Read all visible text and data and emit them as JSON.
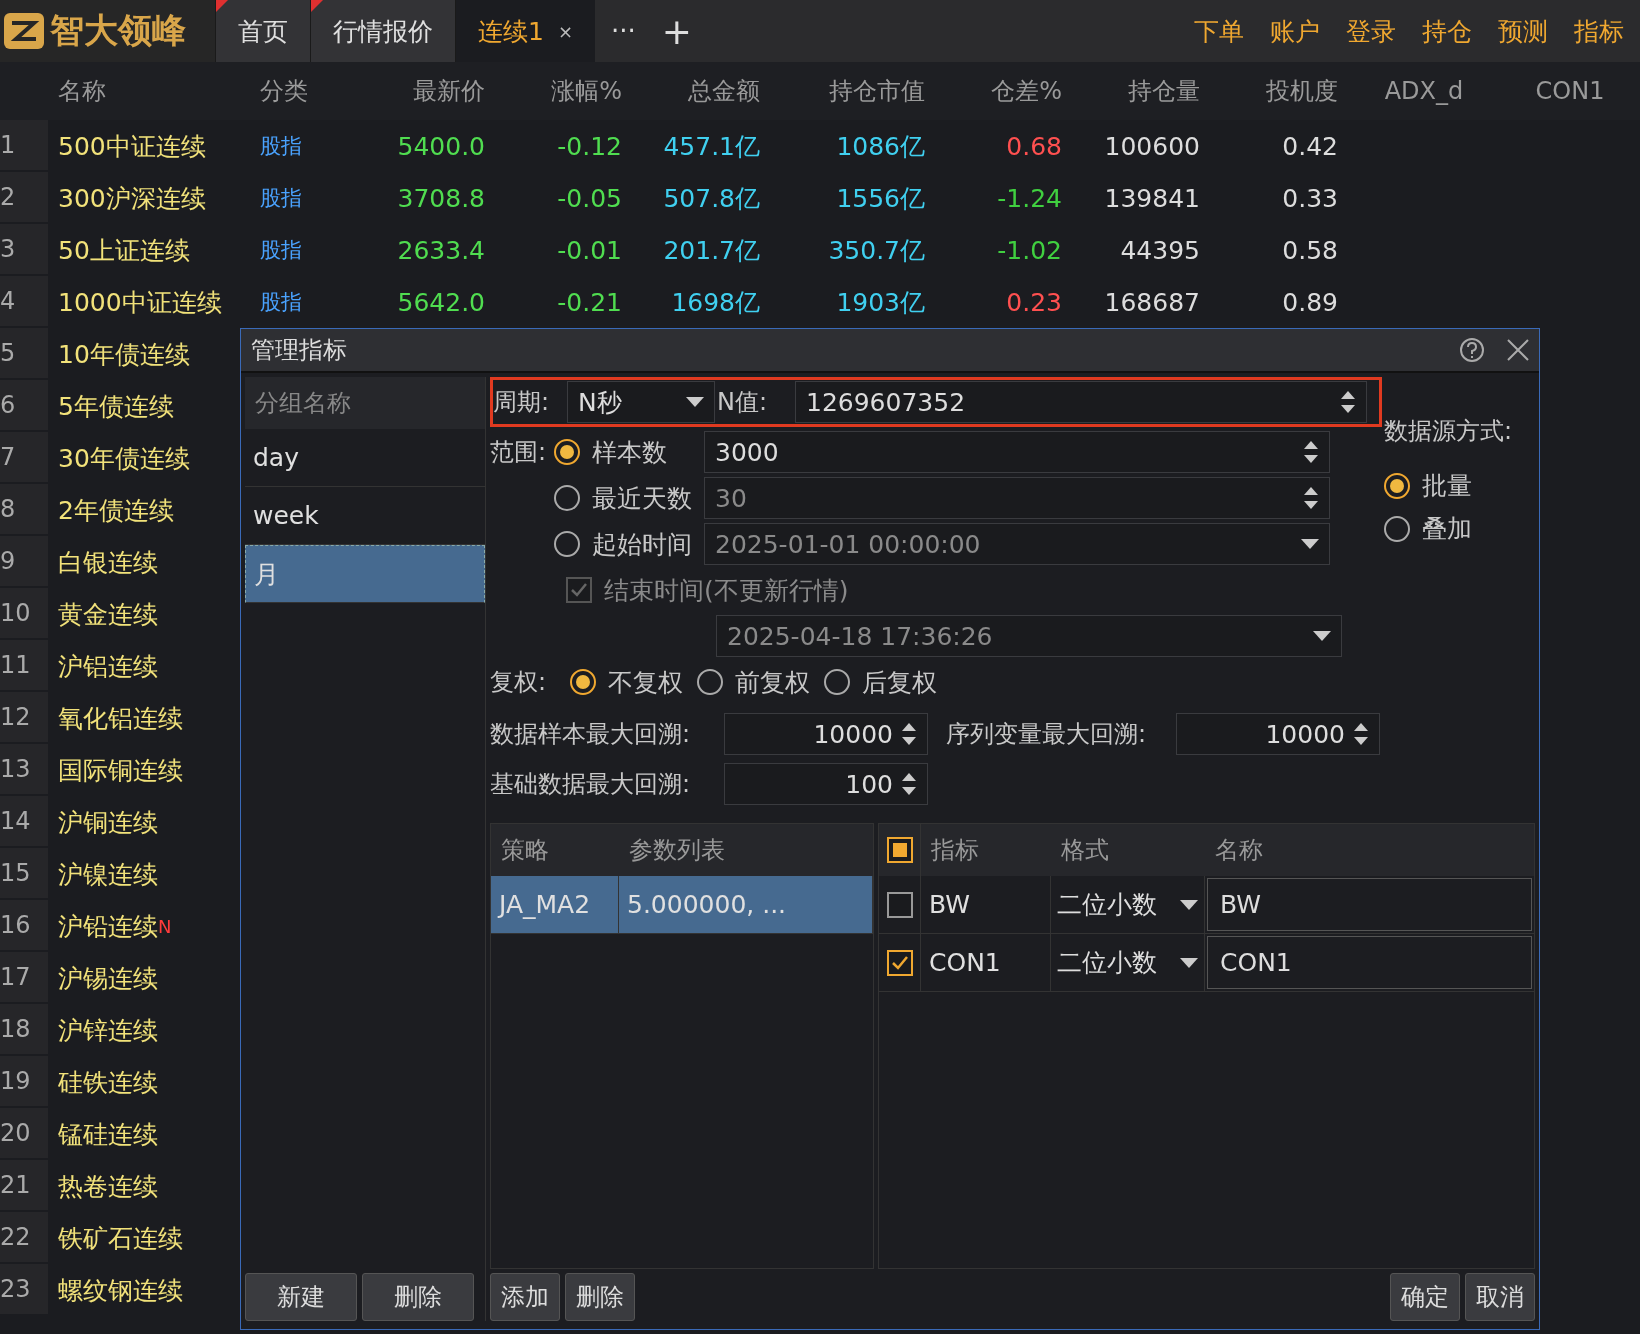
{
  "app": {
    "logo": "智大领峰"
  },
  "tabs": [
    {
      "label": "首页",
      "selected": false,
      "flagged": true
    },
    {
      "label": "行情报价",
      "selected": false,
      "flagged": true
    },
    {
      "label": "连续1",
      "selected": true,
      "flagged": false,
      "close": "×"
    }
  ],
  "tab_more": "···",
  "tab_add": "+",
  "menu": [
    "下单",
    "账户",
    "登录",
    "持仓",
    "预测",
    "指标"
  ],
  "table": {
    "columns": [
      "名称",
      "分类",
      "最新价",
      "涨幅%",
      "总金额",
      "持仓市值",
      "仓差%",
      "持仓量",
      "投机度",
      "ADX_d",
      "CON1"
    ],
    "rows": [
      {
        "no": "1",
        "name": "500中证连续",
        "category": "股指",
        "price": "5400.0",
        "change": "-0.12",
        "amount": "457.1亿",
        "position_value": "1086亿",
        "oi_change": {
          "text": "0.68",
          "color": "#ff5050"
        },
        "open_interest": "100600",
        "speculation": "0.42"
      },
      {
        "no": "2",
        "name": "300沪深连续",
        "category": "股指",
        "price": "3708.8",
        "change": "-0.05",
        "amount": "507.8亿",
        "position_value": "1556亿",
        "oi_change": {
          "text": "-1.24",
          "color": "#40d040"
        },
        "open_interest": "139841",
        "speculation": "0.33"
      },
      {
        "no": "3",
        "name": "50上证连续",
        "category": "股指",
        "price": "2633.4",
        "change": "-0.01",
        "amount": "201.7亿",
        "position_value": "350.7亿",
        "oi_change": {
          "text": "-1.02",
          "color": "#40d040"
        },
        "open_interest": "44395",
        "speculation": "0.58"
      },
      {
        "no": "4",
        "name": "1000中证连续",
        "category": "股指",
        "price": "5642.0",
        "change": "-0.21",
        "amount": "1698亿",
        "position_value": "1903亿",
        "oi_change": {
          "text": "0.23",
          "color": "#ff5050"
        },
        "open_interest": "168687",
        "speculation": "0.89"
      },
      {
        "no": "5",
        "name": "10年债连续"
      },
      {
        "no": "6",
        "name": "5年债连续"
      },
      {
        "no": "7",
        "name": "30年债连续"
      },
      {
        "no": "8",
        "name": "2年债连续"
      },
      {
        "no": "9",
        "name": "白银连续"
      },
      {
        "no": "10",
        "name": "黄金连续"
      },
      {
        "no": "11",
        "name": "沪铝连续"
      },
      {
        "no": "12",
        "name": "氧化铝连续"
      },
      {
        "no": "13",
        "name": "国际铜连续"
      },
      {
        "no": "14",
        "name": "沪铜连续"
      },
      {
        "no": "15",
        "name": "沪镍连续"
      },
      {
        "no": "16",
        "name": "沪铅连续",
        "badge": "N"
      },
      {
        "no": "17",
        "name": "沪锡连续"
      },
      {
        "no": "18",
        "name": "沪锌连续"
      },
      {
        "no": "19",
        "name": "硅铁连续"
      },
      {
        "no": "20",
        "name": "锰硅连续"
      },
      {
        "no": "21",
        "name": "热卷连续"
      },
      {
        "no": "22",
        "name": "铁矿石连续"
      },
      {
        "no": "23",
        "name": "螺纹钢连续"
      }
    ]
  },
  "dialog": {
    "title": "管理指标",
    "groups": {
      "header": "分组名称",
      "items": [
        {
          "label": "day",
          "selected": false
        },
        {
          "label": "week",
          "selected": false
        },
        {
          "label": "月",
          "selected": true
        }
      ]
    },
    "period_label": "周期:",
    "period": "N秒",
    "n_label": "N值:",
    "n_value": "1269607352",
    "range_label": "范围:",
    "range_options": [
      {
        "label": "样本数",
        "selected": true,
        "kind": "spin",
        "value": "3000"
      },
      {
        "label": "最近天数",
        "selected": false,
        "kind": "spin",
        "value": "30"
      },
      {
        "label": "起始时间",
        "selected": false,
        "kind": "dropdown",
        "value": "2025-01-01 00:00:00"
      }
    ],
    "end_time": {
      "label": "结束时间(不更新行情)",
      "checked": true,
      "value": "2025-04-18 17:36:26"
    },
    "adjust_label": "复权:",
    "adjust_options": [
      {
        "label": "不复权",
        "selected": true
      },
      {
        "label": "前复权",
        "selected": false
      },
      {
        "label": "后复权",
        "selected": false
      }
    ],
    "max_sample_label": "数据样本最大回溯:",
    "max_sample": "10000",
    "series_label": "序列变量最大回溯:",
    "series": "10000",
    "base_label": "基础数据最大回溯:",
    "base": "100",
    "source_label": "数据源方式:",
    "source_options": [
      {
        "label": "批量",
        "selected": true
      },
      {
        "label": "叠加",
        "selected": false
      }
    ],
    "strategies": {
      "columns": [
        "策略",
        "参数列表"
      ],
      "rows": [
        {
          "name": "JA_MA2",
          "params": "5.000000, ...",
          "selected": true
        }
      ]
    },
    "indicators": {
      "select_all_partial": true,
      "columns": [
        "指标",
        "格式",
        "名称"
      ],
      "rows": [
        {
          "checked": false,
          "indicator": "BW",
          "format": "二位小数",
          "name": "BW"
        },
        {
          "checked": true,
          "indicator": "CON1",
          "format": "二位小数",
          "name": "CON1"
        }
      ]
    },
    "group_buttons": [
      "新建",
      "删除"
    ],
    "strategy_buttons": [
      "添加",
      "删除"
    ],
    "dialog_buttons": [
      "确定",
      "取消"
    ]
  }
}
